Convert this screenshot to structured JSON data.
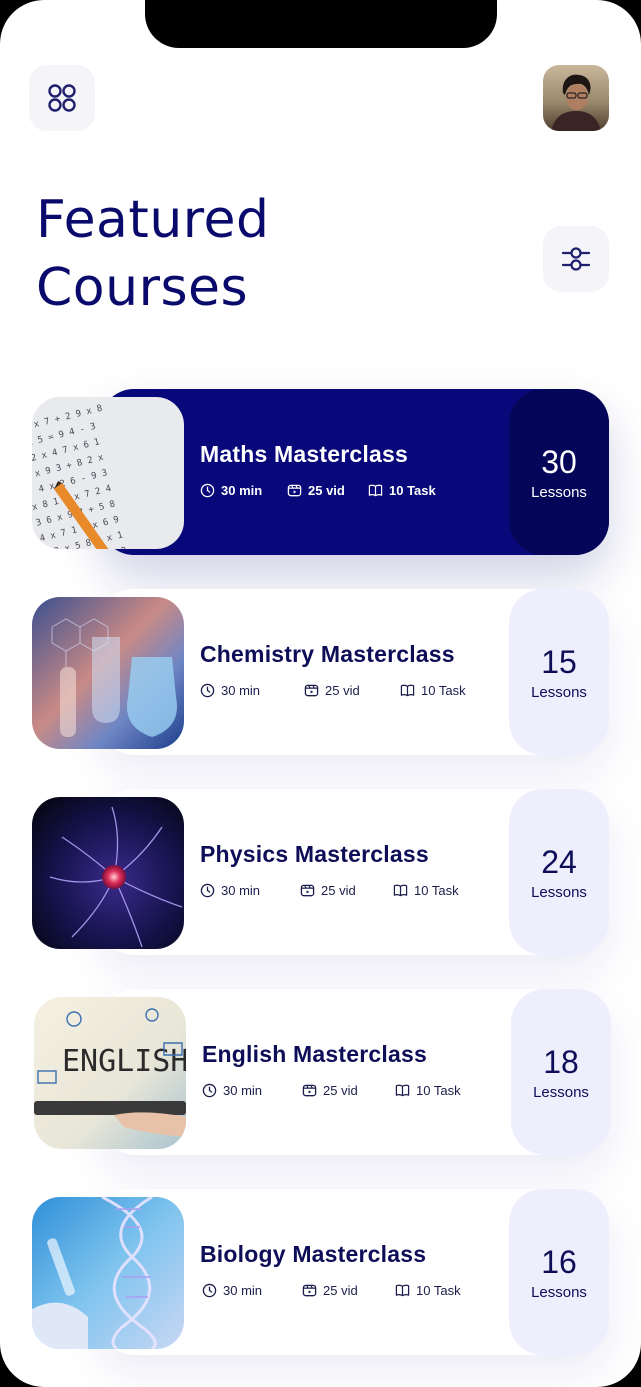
{
  "header": {
    "title": "Featured Courses",
    "menu_icon": "grid-icon",
    "filter_icon": "sliders-icon",
    "avatar": "profile-avatar"
  },
  "courses": [
    {
      "name": "Maths Masterclass",
      "duration": "30 min",
      "videos": "25 vid",
      "tasks": "10 Task",
      "lessons": "30",
      "lessons_label": "Lessons",
      "active": true
    },
    {
      "name": "Chemistry Masterclass",
      "duration": "30 min",
      "videos": "25 vid",
      "tasks": "10 Task",
      "lessons": "15",
      "lessons_label": "Lessons",
      "active": false
    },
    {
      "name": "Physics Masterclass",
      "duration": "30 min",
      "videos": "25 vid",
      "tasks": "10 Task",
      "lessons": "24",
      "lessons_label": "Lessons",
      "active": false
    },
    {
      "name": "English Masterclass",
      "duration": "30 min",
      "videos": "25 vid",
      "tasks": "10 Task",
      "lessons": "18",
      "lessons_label": "Lessons",
      "active": false
    },
    {
      "name": "Biology Masterclass",
      "duration": "30 min",
      "videos": "25 vid",
      "tasks": "10 Task",
      "lessons": "16",
      "lessons_label": "Lessons",
      "active": false
    }
  ],
  "colors": {
    "primary": "#08087a",
    "accent_surface": "#eeeefd",
    "button_surface": "#f4f4f9",
    "text_dark": "#0e0e58"
  }
}
